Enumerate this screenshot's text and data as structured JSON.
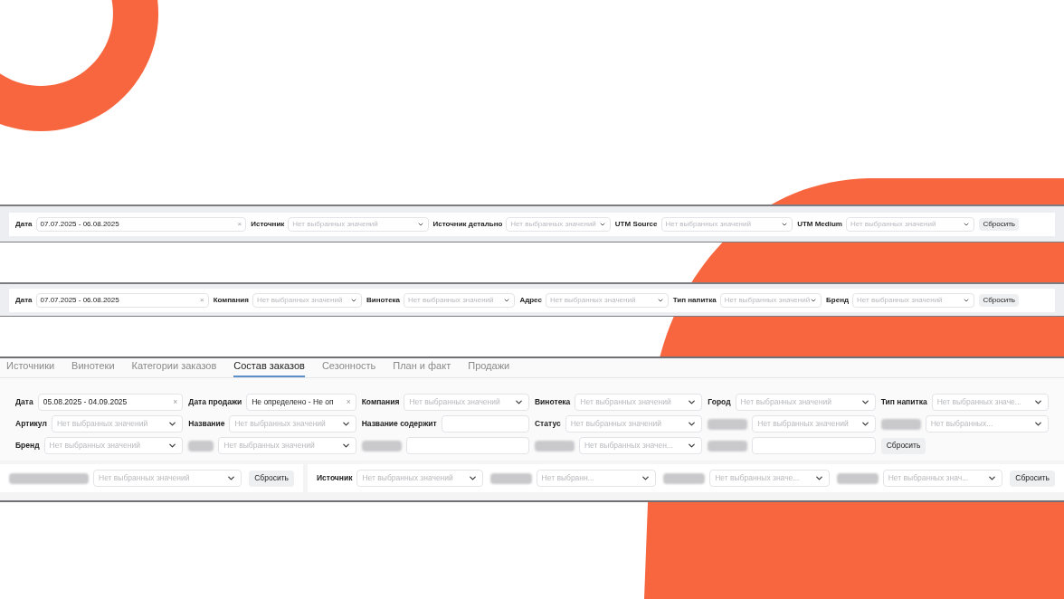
{
  "panels": [
    {
      "kind": "bar",
      "filters": [
        {
          "label": "Дата",
          "kind": "date",
          "value": "07.07.2025 - 06.08.2025",
          "clear": "×"
        },
        {
          "label": "Источник",
          "kind": "select",
          "placeholder": "Нет выбранных значений"
        },
        {
          "label": "Источник детально",
          "kind": "select",
          "placeholder": "Нет выбранных значений"
        },
        {
          "label": "UTM Source",
          "kind": "select",
          "placeholder": "Нет выбранных значений"
        },
        {
          "label": "UTM Medium",
          "kind": "select",
          "placeholder": "Нет выбранных значений"
        }
      ],
      "reset": "Сбросить"
    },
    {
      "kind": "bar",
      "filters": [
        {
          "label": "Дата",
          "kind": "date",
          "value": "07.07.2025 - 06.08.2025",
          "clear": "×"
        },
        {
          "label": "Компания",
          "kind": "select",
          "placeholder": "Нет выбранных значений"
        },
        {
          "label": "Винотека",
          "kind": "select",
          "placeholder": "Нет выбранных значений"
        },
        {
          "label": "Адрес",
          "kind": "select",
          "placeholder": "Нет выбранных значений"
        },
        {
          "label": "Тип напитка",
          "kind": "select",
          "placeholder": "Нет выбранных значений"
        },
        {
          "label": "Бренд",
          "kind": "select",
          "placeholder": "Нет выбранных значений"
        }
      ],
      "reset": "Сбросить"
    },
    {
      "kind": "tabbed",
      "tabs": [
        {
          "label": "Источники",
          "selected": false
        },
        {
          "label": "Винотеки",
          "selected": false
        },
        {
          "label": "Категории заказов",
          "selected": false
        },
        {
          "label": "Состав заказов",
          "selected": true
        },
        {
          "label": "Сезонность",
          "selected": false
        },
        {
          "label": "План и факт",
          "selected": false
        },
        {
          "label": "Продажи",
          "selected": false
        }
      ],
      "rows": [
        [
          {
            "label": "Дата",
            "kind": "date",
            "value": "05.08.2025 - 04.09.2025",
            "clear": "×"
          },
          {
            "label": "Дата продажи",
            "kind": "date",
            "value": "Не определено - Не оп",
            "clear": "×"
          },
          {
            "label": "Компания",
            "kind": "select",
            "placeholder": "Нет выбранных значений"
          },
          {
            "label": "Винотека",
            "kind": "select",
            "placeholder": "Нет выбранных значений"
          },
          {
            "label": "Город",
            "kind": "select",
            "placeholder": "Нет выбранных значений"
          },
          {
            "label": "Тип напитка",
            "kind": "select",
            "placeholder": "Нет выбранных значе..."
          }
        ],
        [
          {
            "label": "Артикул",
            "kind": "select",
            "placeholder": "Нет выбранных значений"
          },
          {
            "label": "Название",
            "kind": "select",
            "placeholder": "Нет выбранных значений"
          },
          {
            "label": "Название содержит",
            "kind": "text"
          },
          {
            "label": "Статус",
            "kind": "select",
            "placeholder": "Нет выбранных значений"
          },
          {
            "redacted_label": true,
            "kind": "select",
            "placeholder": "Нет выбранных значений"
          },
          {
            "redacted_label": true,
            "kind": "select",
            "placeholder": "Нет выбранных..."
          }
        ],
        [
          {
            "label": "Бренд",
            "kind": "select",
            "placeholder": "Нет выбранных значений"
          },
          {
            "redacted_label": true,
            "kind": "select",
            "placeholder": "Нет выбранных значений"
          },
          {
            "redacted_label": true,
            "kind": "text"
          },
          {
            "redacted_label": true,
            "kind": "select",
            "placeholder": "Нет выбранных значен..."
          },
          {
            "redacted_label": true,
            "kind": "text"
          }
        ]
      ],
      "reset": "Сбросить",
      "bottom": [
        {
          "filters": [
            {
              "redacted_label": true,
              "kind": "select",
              "placeholder": "Нет выбранных значений"
            }
          ],
          "reset": "Сбросить"
        },
        {
          "filters": [
            {
              "label": "Источник",
              "kind": "select",
              "placeholder": "Нет выбранных значений"
            },
            {
              "redacted_label": true,
              "kind": "select",
              "placeholder": "Нет выбранн..."
            },
            {
              "redacted_label": true,
              "kind": "select",
              "placeholder": "Нет выбранных значе..."
            },
            {
              "redacted_label": true,
              "kind": "select",
              "placeholder": "Нет выбранных знач..."
            }
          ],
          "reset": "Сбросить"
        }
      ]
    }
  ]
}
